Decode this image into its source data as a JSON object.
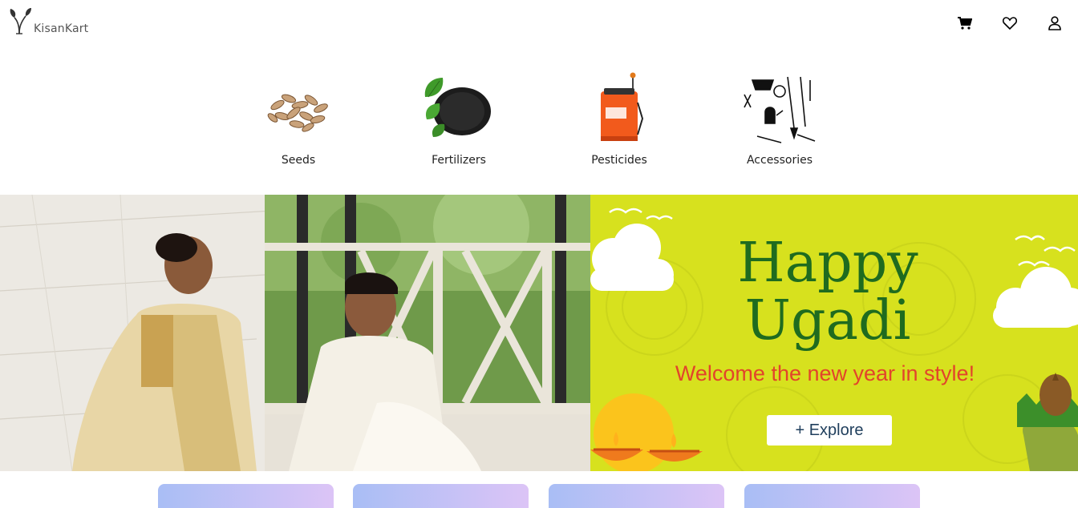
{
  "header": {
    "brand": "KisanKart",
    "icons": [
      "cart-icon",
      "heart-icon",
      "user-icon"
    ]
  },
  "categories": [
    {
      "label": "Seeds",
      "icon": "seeds-image"
    },
    {
      "label": "Fertilizers",
      "icon": "fertilizer-image"
    },
    {
      "label": "Pesticides",
      "icon": "sprayer-image"
    },
    {
      "label": "Accessories",
      "icon": "tools-image"
    }
  ],
  "banner_right": {
    "title_line1": "Happy",
    "title_line2": "Ugadi",
    "subtitle": "Welcome the new year in style!",
    "button_label": "+ Explore"
  },
  "colors": {
    "ugadi_bg": "#d7e11e",
    "ugadi_title": "#1f6b1f",
    "ugadi_subtitle": "#e2442b",
    "card_gradient_start": "#a9bef5",
    "card_gradient_end": "#dcc4f6"
  }
}
